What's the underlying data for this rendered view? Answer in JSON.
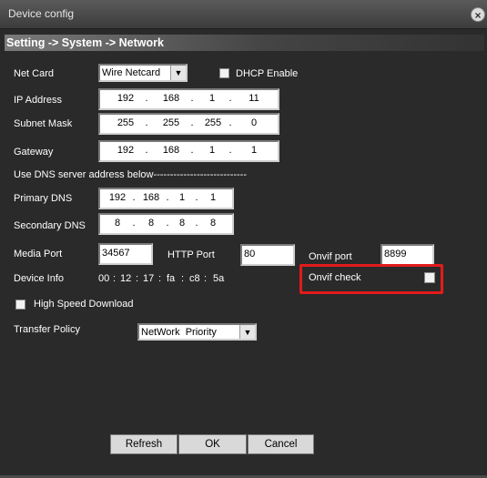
{
  "window": {
    "title": "Device config",
    "close_icon": "close-icon"
  },
  "breadcrumb": "Setting -> System -> Network",
  "net_card": {
    "label": "Net Card",
    "value": "Wire Netcard"
  },
  "dhcp": {
    "label": "DHCP Enable",
    "checked": false
  },
  "ip_address": {
    "label": "IP Address",
    "octets": [
      "192",
      "168",
      "1",
      "11"
    ]
  },
  "subnet_mask": {
    "label": "Subnet Mask",
    "octets": [
      "255",
      "255",
      "255",
      "0"
    ]
  },
  "gateway": {
    "label": "Gateway",
    "octets": [
      "192",
      "168",
      "1",
      "1"
    ]
  },
  "dns_note": "Use DNS server address below----------------------------",
  "primary_dns": {
    "label": "Primary DNS",
    "octets": [
      "192",
      "168",
      "1",
      "1"
    ]
  },
  "secondary_dns": {
    "label": "Secondary DNS",
    "octets": [
      "8",
      "8",
      "8",
      "8"
    ]
  },
  "media_port": {
    "label": "Media Port",
    "value": "34567"
  },
  "http_port": {
    "label": "HTTP Port",
    "value": "80"
  },
  "onvif_port": {
    "label": "Onvif port",
    "value": "8899"
  },
  "device_info": {
    "label": "Device Info",
    "mac": [
      "00",
      "12",
      "17",
      "fa",
      "c8",
      "5a"
    ]
  },
  "onvif_check": {
    "label": "Onvif check",
    "checked": false,
    "highlight_color": "#e31b1b"
  },
  "high_speed": {
    "label": "High Speed Download",
    "checked": false
  },
  "transfer_policy": {
    "label": "Transfer Policy",
    "value": "NetWork  Priority"
  },
  "buttons": {
    "refresh": "Refresh",
    "ok": "OK",
    "cancel": "Cancel"
  }
}
